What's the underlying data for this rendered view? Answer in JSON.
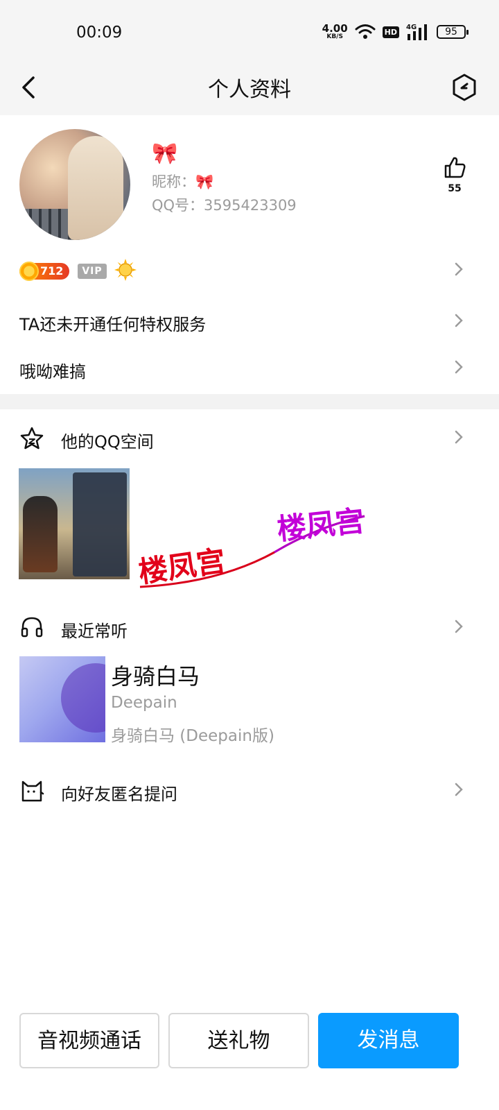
{
  "status_bar": {
    "time": "00:09",
    "net_speed": "4.00",
    "net_unit": "KB/S",
    "hd": "HD",
    "network": "4G",
    "battery": "95"
  },
  "nav": {
    "title": "个人资料"
  },
  "profile": {
    "display_name_emoji": "🎀",
    "nickname": "昵称：🎀",
    "qq_number": "QQ号：3595423309",
    "likes": "55"
  },
  "badges": {
    "coins": "712",
    "vip": "VIP"
  },
  "rows": {
    "privilege": "TA还未开通任何特权服务",
    "signature": "哦呦难搞"
  },
  "qzone": {
    "label": "他的QQ空间",
    "watermark_text": "楼凤宫"
  },
  "music": {
    "label": "最近常听",
    "title": "身骑白马",
    "artist": "Deepain",
    "album": "身骑白马 (Deepain版)"
  },
  "anon_question": {
    "label": "向好友匿名提问"
  },
  "actions": {
    "call": "音视频通话",
    "gift": "送礼物",
    "message": "发消息"
  },
  "colors": {
    "primary": "#0a9bff",
    "muted_text": "#9b9b9b",
    "bar_bg": "#f5f5f5"
  }
}
